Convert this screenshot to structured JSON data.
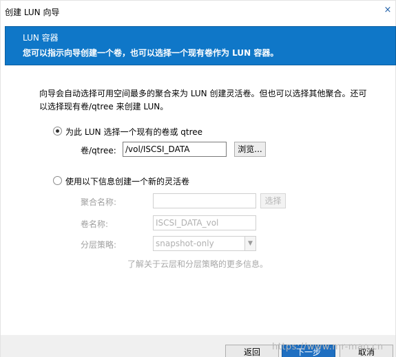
{
  "window": {
    "title": "创建 LUN 向导",
    "close_glyph": "×"
  },
  "banner": {
    "title": "LUN 容器",
    "subtitle": "您可以指示向导创建一个卷，也可以选择一个现有卷作为 LUN 容器。"
  },
  "description": "向导会自动选择可用空间最多的聚合来为 LUN 创建灵活卷。但也可以选择其他聚合。还可以选择现有卷/qtree 来创建 LUN。",
  "option_existing": {
    "label": "为此 LUN 选择一个现有的卷或 qtree",
    "checked": true,
    "volume_label": "卷/qtree:",
    "volume_value": "/vol/ISCSI_DATA",
    "browse_label": "浏览..."
  },
  "option_new": {
    "label": "使用以下信息创建一个新的灵活卷",
    "checked": false,
    "aggregate_label": "聚合名称:",
    "aggregate_value": "",
    "select_label": "选择",
    "volume_name_label": "卷名称:",
    "volume_name_placeholder": "ISCSI_DATA_vol",
    "tiering_label": "分层策略:",
    "tiering_value": "snapshot-only",
    "info_text": "了解关于云层和分层策略的更多信息。"
  },
  "footer": {
    "back_label": "返回",
    "next_label": "下一步",
    "cancel_label": "取消"
  },
  "watermark": "https://www.mr-mao.cn"
}
